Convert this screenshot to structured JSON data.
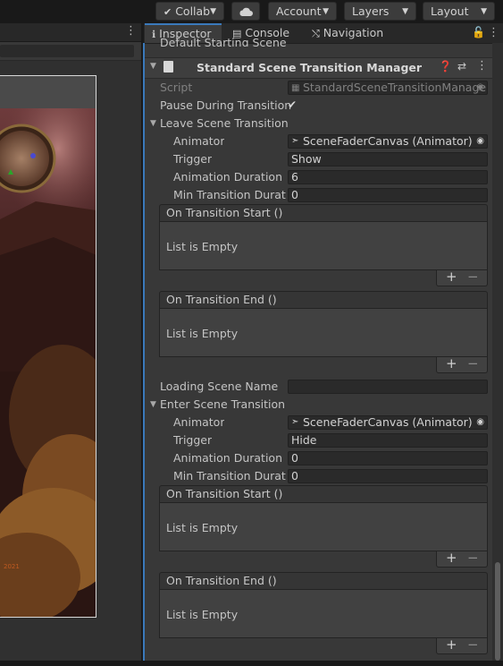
{
  "toolbar": {
    "collab_label": "Collab",
    "account_label": "Account",
    "layers_label": "Layers",
    "layout_label": "Layout"
  },
  "game_overlay": {
    "year_text": "2021"
  },
  "inspector": {
    "tabs": {
      "inspector": "Inspector",
      "console": "Console",
      "navigation": "Navigation"
    },
    "partial_field": "Default Starting Scene Na",
    "component_title": "Standard Scene Transition Manager",
    "script_label": "Script",
    "script_value": "StandardSceneTransitionManage",
    "pause_label": "Pause During Transition",
    "pause_checked": true,
    "leave": {
      "title": "Leave Scene Transition",
      "animator_label": "Animator",
      "animator_value": "SceneFaderCanvas (Animator)",
      "trigger_label": "Trigger",
      "trigger_value": "Show",
      "duration_label": "Animation Duration",
      "duration_value": "6",
      "min_label": "Min Transition Duration",
      "min_value": "0",
      "start_event": "On Transition Start ()",
      "start_empty": "List is Empty",
      "end_event": "On Transition End ()",
      "end_empty": "List is Empty"
    },
    "loading_label": "Loading Scene Name",
    "loading_value": "",
    "enter": {
      "title": "Enter Scene Transition",
      "animator_label": "Animator",
      "animator_value": "SceneFaderCanvas (Animator)",
      "trigger_label": "Trigger",
      "trigger_value": "Hide",
      "duration_label": "Animation Duration",
      "duration_value": "0",
      "min_label": "Min Transition Duration",
      "min_value": "0",
      "start_event": "On Transition Start ()",
      "start_empty": "List is Empty",
      "end_event": "On Transition End ()",
      "end_empty": "List is Empty"
    },
    "plus": "+",
    "minus": "−"
  }
}
